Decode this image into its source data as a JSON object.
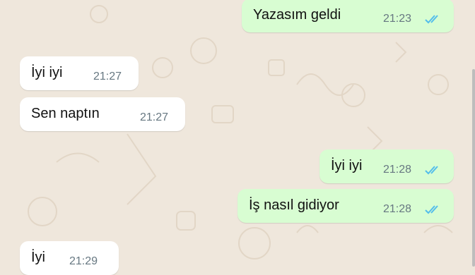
{
  "colors": {
    "background": "#efe7dc",
    "incoming_bubble": "#ffffff",
    "outgoing_bubble": "#d8fdd2",
    "read_tick": "#53bdeb",
    "timestamp": "#667781"
  },
  "messages": [
    {
      "direction": "outgoing",
      "text": "Yazasım geldi",
      "time": "21:23",
      "status_icon": "double-check-read-icon"
    },
    {
      "direction": "incoming",
      "text": "İyi iyi",
      "time": "21:27"
    },
    {
      "direction": "incoming",
      "text": "Sen naptın",
      "time": "21:27"
    },
    {
      "direction": "outgoing",
      "text": "İyi iyi",
      "time": "21:28",
      "status_icon": "double-check-read-icon"
    },
    {
      "direction": "outgoing",
      "text": "İş nasıl gidiyor",
      "time": "21:28",
      "status_icon": "double-check-read-icon"
    },
    {
      "direction": "incoming",
      "text": "İyi",
      "time": "21:29"
    }
  ]
}
